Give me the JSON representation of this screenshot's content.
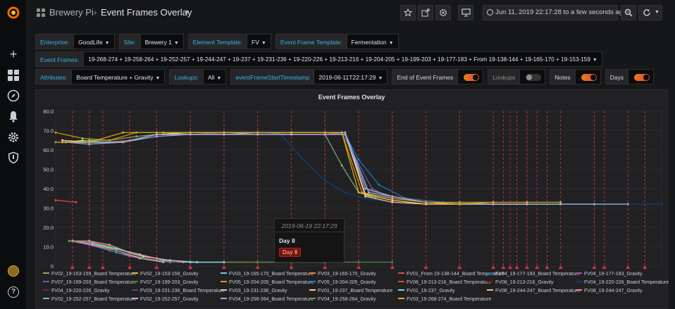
{
  "header": {
    "folder": "Brewery Pi",
    "separator": "›",
    "title": "Event Frames Overlay",
    "time_range": "Jun 11, 2019 22:17:28 to a few seconds ago"
  },
  "variables": {
    "enterprise": {
      "label": "Enterprise:",
      "value": "GoodLife"
    },
    "site": {
      "label": "Site:",
      "value": "Brewery 1"
    },
    "element_template": {
      "label": "Element Template:",
      "value": "FV"
    },
    "event_frame_template": {
      "label": "Event Frame Template:",
      "value": "Fermentation"
    },
    "event_frames": {
      "label": "Event Frames:",
      "value": "19-268-274 + 19-258-264 + 19-252-257 + 19-244-247 + 19-237 + 19-231-236 + 19-220-226 + 19-213-216 + 19-204-205 + 19-199-203 + 19-177-183 + From 19-138-144 + 19-165-170 + 19-153-159"
    },
    "attributes": {
      "label": "Attributes:",
      "value": "Board Temperature + Gravity"
    },
    "lookups": {
      "label": "Lookups:",
      "value": "All"
    },
    "start_ts": {
      "label": "eventFrameStartTimestamp",
      "value": "2019-06-11T22:17:29"
    },
    "end_of_event_frames": {
      "label": "End of Event Frames",
      "on": true
    },
    "lookups_switch": {
      "label": "Lookups",
      "on": false
    },
    "notes": {
      "label": "Notes",
      "on": true
    },
    "days": {
      "label": "Days",
      "on": true
    }
  },
  "panel": {
    "title": "Event Frames Overlay"
  },
  "tooltip": {
    "time": "2019-06-19 22:17:29",
    "title": "Day 8",
    "badge": "Day 8"
  },
  "icons": {
    "grid": "grid-icon",
    "star": "star-icon",
    "share": "share-icon",
    "settings": "gear-icon",
    "tv": "tv-icon",
    "zoom": "zoom-out-icon",
    "refresh": "refresh-icon"
  },
  "chart_data": {
    "type": "line",
    "title": "Event Frames Overlay",
    "xlabel": "",
    "ylabel": "",
    "ylim": [
      0,
      80
    ],
    "xlim": [
      0,
      18
    ],
    "yticks": [
      "0",
      "10.0",
      "20.0",
      "30.0",
      "40.0",
      "50.0",
      "60.0",
      "70.0",
      "80.0"
    ],
    "grid": true,
    "legend_position": "bottom",
    "series": [
      {
        "name": "FV02_19-153-159_Board Temperature",
        "color": "#7eb26d",
        "x": [
          0,
          0.5,
          1,
          1.6,
          2.4,
          3,
          4,
          5,
          6,
          7,
          8,
          8.5,
          9,
          9.5,
          10,
          11,
          12,
          13,
          15
        ],
        "y": [
          64,
          64,
          65,
          65,
          67,
          68,
          69,
          69,
          69,
          68,
          68,
          52,
          38,
          35,
          33,
          32,
          32,
          32,
          32
        ]
      },
      {
        "name": "FV02_19-153-159_Gravity",
        "color": "#eab839",
        "x": [
          0.4,
          1,
          1.5,
          2,
          2.5,
          3,
          4,
          5,
          6,
          7,
          8
        ],
        "y": [
          13,
          12,
          10,
          7,
          5,
          3,
          2,
          2,
          2,
          2,
          2
        ]
      },
      {
        "name": "FV03_19-165-170_Board Temperature",
        "color": "#6ed0e0",
        "x": [
          0.3,
          0.8,
          1.5,
          2.2,
          3,
          4,
          5,
          6,
          7,
          8,
          8.6,
          9.2,
          10,
          11,
          12,
          13,
          14,
          15,
          16
        ],
        "y": [
          64,
          65,
          64,
          65,
          68,
          68,
          69,
          69,
          69,
          69,
          69,
          40,
          36,
          33,
          32,
          32,
          32,
          32,
          32
        ]
      },
      {
        "name": "FV03_19-165-170_Gravity",
        "color": "#ef843c",
        "x": [
          0.5,
          1,
          1.6,
          2.2,
          3,
          4,
          5,
          6
        ],
        "y": [
          13,
          12,
          9,
          6,
          3,
          2,
          2,
          2
        ]
      },
      {
        "name": "FV01_From 19-138-144_Board Temperature",
        "color": "#e24d42",
        "x": [
          0,
          0.6
        ],
        "y": [
          34,
          33
        ]
      },
      {
        "name": "FV04_19-177-183_Board Temperature",
        "color": "#1f78c1",
        "x": [
          0.2,
          1,
          2,
          3,
          4,
          5,
          6,
          7,
          8,
          8.6,
          9,
          9.6,
          10.4,
          11.5,
          13,
          14,
          15,
          16,
          17
        ],
        "y": [
          64,
          64,
          64,
          68,
          68,
          69,
          69,
          69,
          69,
          68,
          55,
          42,
          35,
          33,
          32,
          32,
          32,
          32,
          32
        ]
      },
      {
        "name": "FV04_19-177-183_Gravity",
        "color": "#ba43a9",
        "x": [
          0.4,
          1,
          1.6,
          2.2,
          3,
          4,
          5
        ],
        "y": [
          13,
          11,
          8,
          5,
          3,
          2,
          2
        ]
      },
      {
        "name": "FV07_19-199-203_Board Temperature",
        "color": "#705da0",
        "x": [
          0.3,
          1,
          2,
          3,
          4,
          5,
          6,
          7,
          8,
          8.5,
          9.4,
          10,
          11,
          12,
          13
        ],
        "y": [
          64,
          63,
          64,
          68,
          68,
          69,
          69,
          69,
          69,
          69,
          40,
          35,
          33,
          32,
          32
        ]
      },
      {
        "name": "FV07_19-199-203_Gravity",
        "color": "#508642",
        "x": [
          0.5,
          1,
          1.5,
          2,
          2.5,
          3,
          4,
          5,
          6,
          7,
          8,
          9,
          10
        ],
        "y": [
          13,
          12,
          11,
          8,
          5,
          3,
          2,
          2,
          2,
          2,
          2,
          2,
          2
        ]
      },
      {
        "name": "FV05_19-204-205_Board Temperature",
        "color": "#cca300",
        "x": [
          0,
          0.8,
          1.6,
          2.4,
          3.2,
          4,
          5,
          6,
          7,
          8,
          8.5,
          9.1,
          10,
          11,
          12,
          13
        ],
        "y": [
          69,
          66,
          65,
          69,
          69,
          69,
          69,
          69,
          69,
          69,
          69,
          38,
          35,
          33,
          33,
          33
        ]
      },
      {
        "name": "FV05_19-204-205_Gravity",
        "color": "#447ebc",
        "x": [
          0.5,
          1.1,
          1.8,
          2.6,
          3.4,
          4.2
        ],
        "y": [
          13,
          11,
          7,
          4,
          2,
          2
        ]
      },
      {
        "name": "FV08_19-213-216_Board Temperature",
        "color": "#c15c17",
        "x": [
          0.1,
          0.8,
          1.5,
          2.2,
          3,
          4,
          5,
          6,
          7,
          8,
          8.6,
          9.2,
          10,
          11,
          12,
          13,
          14
        ],
        "y": [
          64,
          64,
          64,
          65,
          68,
          68,
          68,
          68,
          68,
          68,
          69,
          36,
          33,
          32,
          32,
          32,
          32
        ]
      },
      {
        "name": "FV08_19-213-216_Gravity",
        "color": "#890f02",
        "x": [
          0.5,
          1.2,
          2,
          2.8,
          3.6
        ],
        "y": [
          13,
          12,
          8,
          4,
          2
        ]
      },
      {
        "name": "FV04_19-220-226_Board Temperature",
        "color": "#0a437c",
        "x": [
          0.2,
          1,
          2,
          3,
          4,
          5,
          6,
          6.7,
          7.3,
          8,
          8.6,
          9.2,
          10,
          11,
          12,
          13,
          14,
          15,
          16,
          17,
          18
        ],
        "y": [
          64,
          64,
          64,
          68,
          68,
          68,
          69,
          68,
          56,
          44,
          38,
          35,
          33,
          32,
          32,
          32,
          32,
          32,
          32,
          32,
          32
        ]
      },
      {
        "name": "FV04_19-220-226_Gravity",
        "color": "#6d1f62",
        "x": [
          0.5,
          1.2,
          2,
          2.8,
          3.6
        ],
        "y": [
          13,
          11,
          7,
          4,
          2
        ]
      },
      {
        "name": "FV03_19-231-236_Board Temperature",
        "color": "#584477",
        "x": [
          0.3,
          1,
          2,
          3,
          4,
          5,
          6,
          7,
          8,
          8.6,
          9.3,
          10,
          11,
          12,
          13,
          14,
          15,
          16,
          17
        ],
        "y": [
          64,
          64,
          64,
          67,
          68,
          68,
          68,
          68,
          68,
          68,
          39,
          35,
          33,
          32,
          32,
          32,
          32,
          32,
          32
        ]
      },
      {
        "name": "FV03_19-231-236_Gravity",
        "color": "#b7dbab",
        "x": [
          0.5,
          1,
          1.8,
          2.6,
          3.4,
          4.2
        ],
        "y": [
          13,
          12,
          9,
          5,
          3,
          2
        ]
      },
      {
        "name": "FV01_19-237_Board Temperature",
        "color": "#f4d598",
        "x": [
          0.2,
          1,
          2,
          3,
          4,
          5,
          6,
          7,
          8,
          8.6,
          9.2,
          10,
          11,
          12,
          13,
          14,
          15
        ],
        "y": [
          65,
          64,
          64,
          68,
          69,
          69,
          69,
          69,
          69,
          69,
          37,
          34,
          32,
          32,
          32,
          32,
          32
        ]
      },
      {
        "name": "FV01_19-237_Gravity",
        "color": "#70dbed",
        "x": [
          0.5,
          1.1,
          1.8,
          2.5,
          3.2,
          4,
          5
        ],
        "y": [
          13,
          12,
          9,
          6,
          3,
          2,
          2
        ]
      },
      {
        "name": "FV08_19-244-247_Board Temperature",
        "color": "#f9ba8f",
        "x": [
          0.3,
          1,
          2,
          3,
          4,
          5,
          6,
          7,
          8,
          8.6,
          9.2,
          10,
          11,
          12,
          13,
          14
        ],
        "y": [
          64,
          64,
          64,
          68,
          68,
          68,
          68,
          68,
          68,
          68,
          36,
          33,
          32,
          32,
          32,
          32
        ]
      },
      {
        "name": "FV08_19-244-247_Gravity",
        "color": "#f29191",
        "x": [
          0.5,
          1,
          1.6,
          2.2,
          3,
          3.8
        ],
        "y": [
          13,
          13,
          11,
          7,
          4,
          2
        ]
      },
      {
        "name": "FV02_19-252-257_Board Temperature",
        "color": "#82b5d8",
        "x": [
          0.3,
          1,
          2,
          3,
          4,
          5,
          6,
          7,
          8,
          8.6,
          9.3,
          10,
          11,
          12,
          13,
          14,
          15,
          16,
          17
        ],
        "y": [
          64,
          63,
          64,
          68,
          68,
          68,
          69,
          69,
          69,
          69,
          38,
          36,
          33,
          32,
          32,
          32,
          32,
          32,
          32
        ]
      },
      {
        "name": "FV02_19-252-257_Gravity",
        "color": "#e5a8e2",
        "x": [
          0.5,
          1.1,
          1.8,
          2.5,
          3.2
        ],
        "y": [
          13,
          11,
          8,
          4,
          2
        ]
      },
      {
        "name": "FV04_19-258-264_Board Temperature",
        "color": "#aea2e0",
        "x": [
          0.2,
          1,
          2,
          3,
          4,
          5,
          6,
          7,
          8,
          8.6,
          9.2,
          10,
          11,
          12,
          13,
          14
        ],
        "y": [
          64,
          64,
          64,
          67,
          68,
          68,
          68,
          68,
          68,
          68,
          40,
          36,
          33,
          32,
          32,
          32
        ]
      },
      {
        "name": "FV04_19-258-264_Gravity",
        "color": "#629e51",
        "x": [
          0.4,
          1,
          1.8,
          2.6,
          3.4
        ],
        "y": [
          13,
          12,
          8,
          4,
          2
        ]
      },
      {
        "name": "FV03_19-268-274_Board Temperature",
        "color": "#e5ac0e",
        "x": [
          0.2,
          1,
          2,
          3,
          4,
          5,
          6,
          7,
          8,
          8.5,
          9,
          10,
          11,
          12,
          13,
          14,
          15
        ],
        "y": [
          64,
          64,
          69,
          69,
          69,
          69,
          69,
          69,
          69,
          69,
          38,
          35,
          33,
          32,
          33,
          33,
          33
        ]
      }
    ],
    "annotations": {
      "color": "#e02f44",
      "x": [
        0.5,
        1,
        1.4,
        2.2,
        3,
        4,
        5,
        6,
        7,
        8,
        9,
        10,
        11,
        12,
        13,
        13.3,
        13.5,
        13.7,
        14,
        14.3,
        14.6,
        15,
        16,
        16.3,
        17,
        17.5
      ]
    }
  }
}
